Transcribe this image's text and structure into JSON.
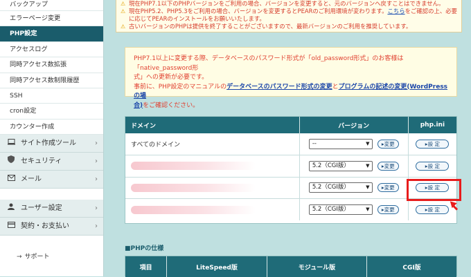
{
  "sidebar": {
    "items": [
      {
        "label": "バックアップ"
      },
      {
        "label": "エラーページ変更"
      },
      {
        "label": "PHP設定"
      },
      {
        "label": "アクセスログ"
      },
      {
        "label": "同時アクセス数拡張"
      },
      {
        "label": "同時アクセス数制限履歴"
      },
      {
        "label": "SSH"
      },
      {
        "label": "cron設定"
      },
      {
        "label": "カウンター作成"
      }
    ],
    "categories": [
      {
        "label": "サイト作成ツール",
        "icon": "monitor-icon"
      },
      {
        "label": "セキュリティ",
        "icon": "shield-icon"
      },
      {
        "label": "メール",
        "icon": "mail-icon"
      },
      {
        "label": "ユーザー設定",
        "icon": "user-icon"
      },
      {
        "label": "契約・お支払い",
        "icon": "card-icon"
      }
    ],
    "support_label": "サポート"
  },
  "notice_top": {
    "line1": "現在PHP7.1以下のPHPバージョンをご利用の場合、バージョンを変更すると、元のバージョンへ戻すことはできません。",
    "line2a": "現在PHP5.2、PHP5.3をご利用の場合、バージョンを変更するとPEARのご利用環境が変わります。",
    "line2_link": "こちら",
    "line2b": "をご確認の上、必要",
    "line3": "に応じてPEARのインストールをお願いいたします。",
    "line4": "古いバージョンのPHPは提供を終了することがございますので、最新バージョンのご利用を推奨しています。"
  },
  "notice_box": {
    "line1": "PHP7.1以上に変更する際、データベースのパスワード形式が「old_password形式」のお客様は「native_password形",
    "line2": "式」への更新が必要です。",
    "line3_pre": "事前に、PHP設定のマニュアルの",
    "link1": "データベースのパスワード形式の変更",
    "line3_mid": "と",
    "link2": "プログラムの記述の変更(WordPressの場",
    "line4_link": "合)",
    "line4_post": "をご確認ください。"
  },
  "domain_table": {
    "headers": {
      "domain": "ドメイン",
      "version": "バージョン",
      "ini": "php.ini"
    },
    "change_label": "変更",
    "ini_label": "設 定",
    "rows": [
      {
        "domain": "すべてのドメイン",
        "version": "--"
      },
      {
        "domain": "",
        "version": "5.2（CGI版）"
      },
      {
        "domain": "",
        "version": "5.2（CGI版）"
      },
      {
        "domain": "",
        "version": "5.2（CGI版）"
      }
    ]
  },
  "spec": {
    "title": "■PHPの仕様",
    "headers": [
      "項目",
      "LiteSpeed版",
      "モジュール版",
      "CGI版"
    ]
  },
  "colors": {
    "accent": "#1f6b78",
    "highlight": "#e81c1c",
    "notice_text": "#e03f2f"
  }
}
